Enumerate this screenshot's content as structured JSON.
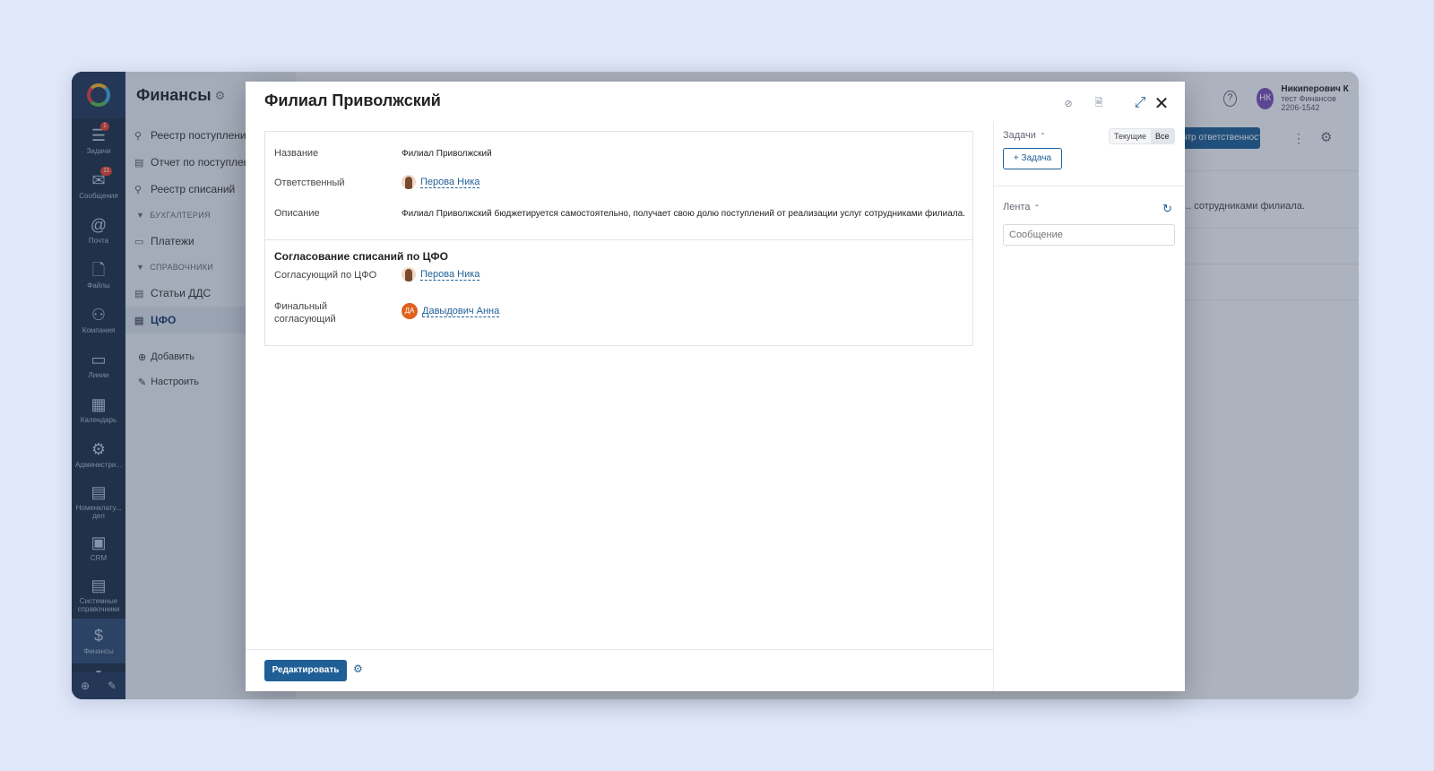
{
  "rail": {
    "items": [
      {
        "icon": "☰",
        "label": "Задачи",
        "badge": "1"
      },
      {
        "icon": "✉",
        "label": "Сообщения",
        "badge": "11"
      },
      {
        "icon": "@",
        "label": "Почта"
      },
      {
        "icon": "🗋",
        "label": "Файлы"
      },
      {
        "icon": "⚇",
        "label": "Компания"
      },
      {
        "icon": "▭",
        "label": "Линии"
      },
      {
        "icon": "▦",
        "label": "Календарь"
      },
      {
        "icon": "⚙",
        "label": "Администри..."
      },
      {
        "icon": "▤",
        "label": "Номенклату... дел"
      },
      {
        "icon": "▣",
        "label": "CRM"
      },
      {
        "icon": "▤",
        "label": "Системные справочники"
      },
      {
        "icon": "$",
        "label": "Финансы"
      }
    ]
  },
  "sidebar": {
    "title": "Финансы",
    "items": [
      {
        "label": "Реестр поступлений"
      },
      {
        "label": "Отчет по поступлениям"
      },
      {
        "label": "Реестр списаний"
      }
    ],
    "section_accounting": "БУХГАЛТЕРИЯ",
    "accounting_items": [
      {
        "label": "Платежи"
      }
    ],
    "section_refs": "СПРАВОЧНИКИ",
    "ref_items": [
      {
        "label": "Статьи ДДС"
      },
      {
        "label": "ЦФО"
      }
    ],
    "add_label": "Добавить",
    "configure_label": "Настроить"
  },
  "header": {
    "user_initials": "НК",
    "user_name": "Никиперович К",
    "user_sub": "тест Финансов 2206-1542",
    "bg_button": "Центр ответственности",
    "bg_text": "... сотрудниками филиала."
  },
  "modal": {
    "title": "Филиал Приволжский",
    "fields": {
      "name_label": "Название",
      "name_value": "Филиал Приволжский",
      "responsible_label": "Ответственный",
      "responsible_value": "Перова Ника",
      "description_label": "Описание",
      "description_value": "Филиал Приволжский бюджетируется самостоятельно, получает свою долю поступлений от реализации услуг сотрудниками филиала."
    },
    "approval": {
      "heading": "Согласование списаний по ЦФО",
      "approver_label": "Согласующий по ЦФО",
      "approver_value": "Перова Ника",
      "final_label": "Финальный согласующий",
      "final_initials": "ДА",
      "final_value": "Давыдович Анна"
    },
    "edit_button": "Редактировать",
    "right": {
      "tasks_label": "Задачи",
      "seg_current": "Текущие",
      "seg_all": "Все",
      "add_task": "+ Задача",
      "feed_label": "Лента",
      "message_placeholder": "Сообщение"
    }
  },
  "colors": {
    "accent": "#1f5f96",
    "rail_bg": "#1c2e45",
    "page_bg": "#dfe7f8"
  }
}
